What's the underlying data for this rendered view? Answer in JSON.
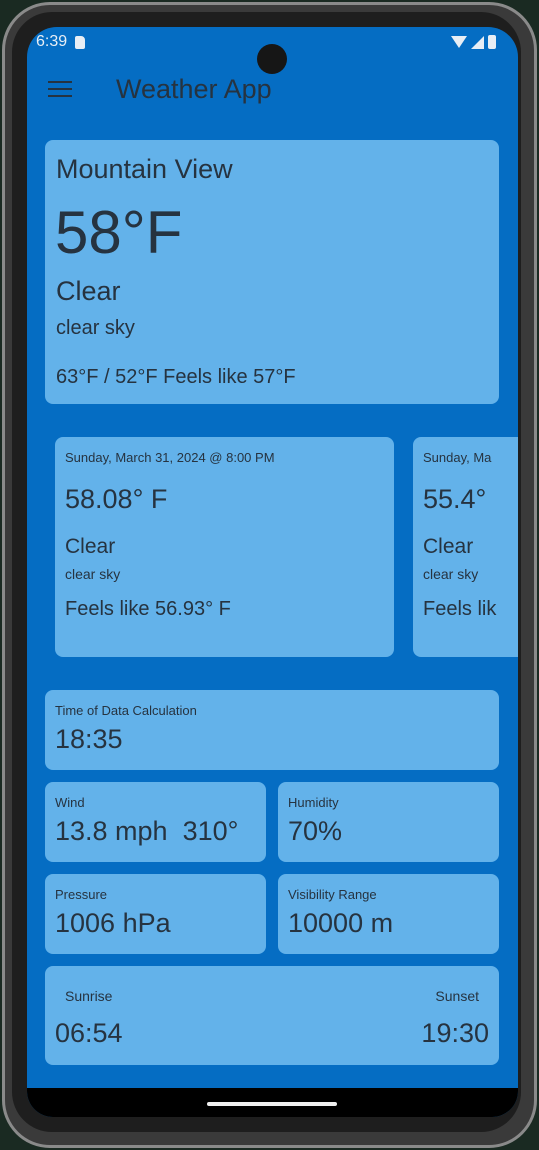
{
  "status": {
    "time": "6:39"
  },
  "app": {
    "title": "Weather App"
  },
  "current": {
    "city": "Mountain View",
    "temp": "58°F",
    "main": "Clear",
    "desc": "clear sky",
    "range": "63°F / 52°F Feels like 57°F"
  },
  "forecast": [
    {
      "date": "Sunday, March 31, 2024 @ 8:00 PM",
      "temp": "58.08° F",
      "main": "Clear",
      "desc": "clear sky",
      "feels": "Feels like 56.93° F"
    },
    {
      "date": "Sunday, Ma",
      "temp": "55.4°",
      "main": "Clear",
      "desc": "clear sky",
      "feels": "Feels lik"
    }
  ],
  "details": {
    "calc_label": "Time of Data Calculation",
    "calc_value": "18:35",
    "wind_label": "Wind",
    "wind_value": "13.8 mph  310°",
    "humidity_label": "Humidity",
    "humidity_value": "70%",
    "pressure_label": "Pressure",
    "pressure_value": "1006 hPa",
    "visibility_label": "Visibility Range",
    "visibility_value": "10000 m",
    "sunrise_label": "Sunrise",
    "sunrise_value": "06:54",
    "sunset_label": "Sunset",
    "sunset_value": "19:30"
  }
}
